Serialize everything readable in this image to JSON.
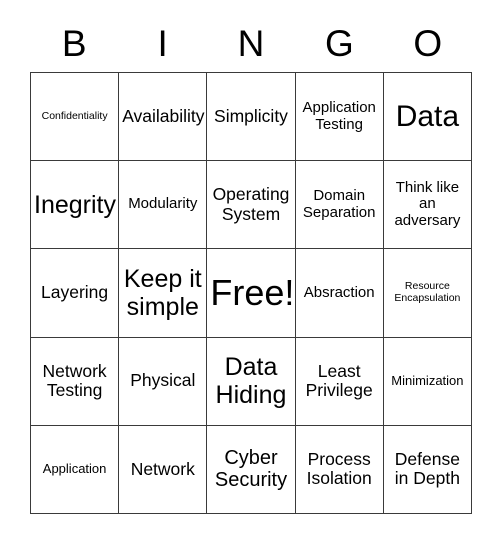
{
  "card": {
    "title_letters": [
      "B",
      "I",
      "N",
      "G",
      "O"
    ],
    "free_space_label": "Free!",
    "grid_size": "5x5",
    "border_color": "#3a3a3a",
    "background_color": "#ffffff",
    "text_color": "#000000"
  },
  "header": {
    "b": "B",
    "i": "I",
    "n": "N",
    "g": "G",
    "o": "O"
  },
  "grid": {
    "rows": [
      [
        {
          "text": "Confidentiality",
          "size": "fs-xxs"
        },
        {
          "text": "Availability",
          "size": "fs-m"
        },
        {
          "text": "Simplicity",
          "size": "fs-m"
        },
        {
          "text": "Application\nTesting",
          "size": "fs-s"
        },
        {
          "text": "Data",
          "size": "fs-xxl"
        }
      ],
      [
        {
          "text": "Inegrity",
          "size": "fs-xl"
        },
        {
          "text": "Modularity",
          "size": "fs-s"
        },
        {
          "text": "Operating\nSystem",
          "size": "fs-m"
        },
        {
          "text": "Domain\nSeparation",
          "size": "fs-s"
        },
        {
          "text": "Think like\nan\nadversary",
          "size": "fs-s"
        }
      ],
      [
        {
          "text": "Layering",
          "size": "fs-m"
        },
        {
          "text": "Keep it\nsimple",
          "size": "fs-xl"
        },
        {
          "text": "Free!",
          "size": "fs-free"
        },
        {
          "text": "Absraction",
          "size": "fs-s"
        },
        {
          "text": "Resource\nEncapsulation",
          "size": "fs-xxs"
        }
      ],
      [
        {
          "text": "Network\nTesting",
          "size": "fs-m"
        },
        {
          "text": "Physical",
          "size": "fs-m"
        },
        {
          "text": "Data\nHiding",
          "size": "fs-xl"
        },
        {
          "text": "Least\nPrivilege",
          "size": "fs-m"
        },
        {
          "text": "Minimization",
          "size": "fs-xs"
        }
      ],
      [
        {
          "text": "Application",
          "size": "fs-xs"
        },
        {
          "text": "Network",
          "size": "fs-m"
        },
        {
          "text": "Cyber\nSecurity",
          "size": "fs-l"
        },
        {
          "text": "Process\nIsolation",
          "size": "fs-m"
        },
        {
          "text": "Defense\nin Depth",
          "size": "fs-m"
        }
      ]
    ]
  }
}
